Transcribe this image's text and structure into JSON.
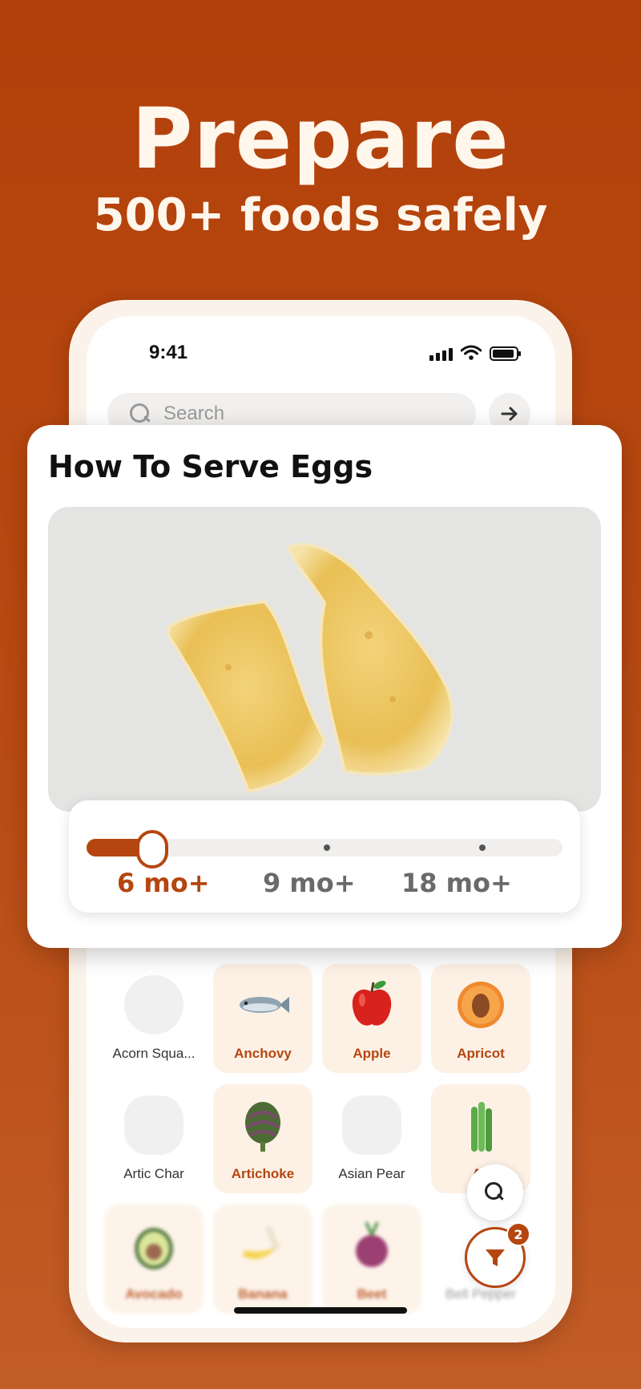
{
  "headline": "Prepare",
  "subhead": "500+ foods safely",
  "status": {
    "time": "9:41"
  },
  "search": {
    "placeholder": "Search",
    "go_icon": "arrow-right-icon"
  },
  "card": {
    "title": "How To Serve Eggs",
    "photo": "egg-strips-photo",
    "age_slider": {
      "stops": [
        "6 mo+",
        "9 mo+",
        "18 mo+"
      ],
      "selected_index": 0
    }
  },
  "foods": [
    {
      "label": "Acorn Squa...",
      "icon": "acorn-squash",
      "available": false
    },
    {
      "label": "Anchovy",
      "icon": "fish",
      "available": true
    },
    {
      "label": "Apple",
      "icon": "apple",
      "available": true
    },
    {
      "label": "Apricot",
      "icon": "apricot",
      "available": true
    },
    {
      "label": "Artic Char",
      "icon": "fish",
      "available": false
    },
    {
      "label": "Artichoke",
      "icon": "artichoke",
      "available": true
    },
    {
      "label": "Asian Pear",
      "icon": "pear",
      "available": false
    },
    {
      "label": "As",
      "icon": "asparagus",
      "available": true
    },
    {
      "label": "Avocado",
      "icon": "avocado",
      "available": true
    },
    {
      "label": "Banana",
      "icon": "banana",
      "available": true
    },
    {
      "label": "Beet",
      "icon": "beet",
      "available": true
    },
    {
      "label": "Bell Pepper",
      "icon": "bell-pepper",
      "available": false
    }
  ],
  "filter_badge": "2",
  "colors": {
    "accent": "#b54610",
    "background": "#b3400a",
    "tile": "#fdf1e6"
  }
}
